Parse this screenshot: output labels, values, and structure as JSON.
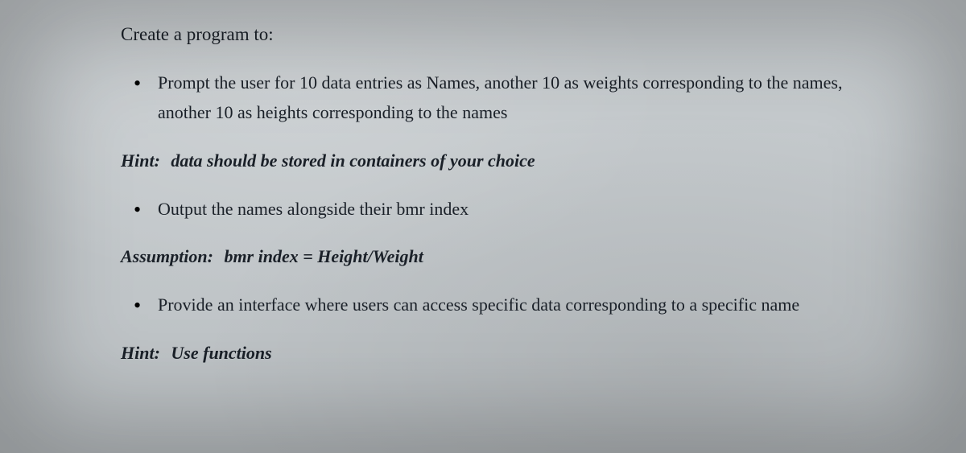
{
  "intro": "Create a program to:",
  "bullets": {
    "b1": "Prompt the user for 10 data entries as Names, another 10 as weights corresponding to the names, another 10 as heights corresponding to the names",
    "b2": "Output the names alongside their bmr index",
    "b3": "Provide an interface where users can access specific data corresponding to a specific name"
  },
  "hints": {
    "label1": "Hint:",
    "h1": "data should be stored in containers of your choice",
    "label2": "Assumption:",
    "h2": "bmr index = Height/Weight",
    "label3": "Hint:",
    "h3": "Use functions"
  }
}
